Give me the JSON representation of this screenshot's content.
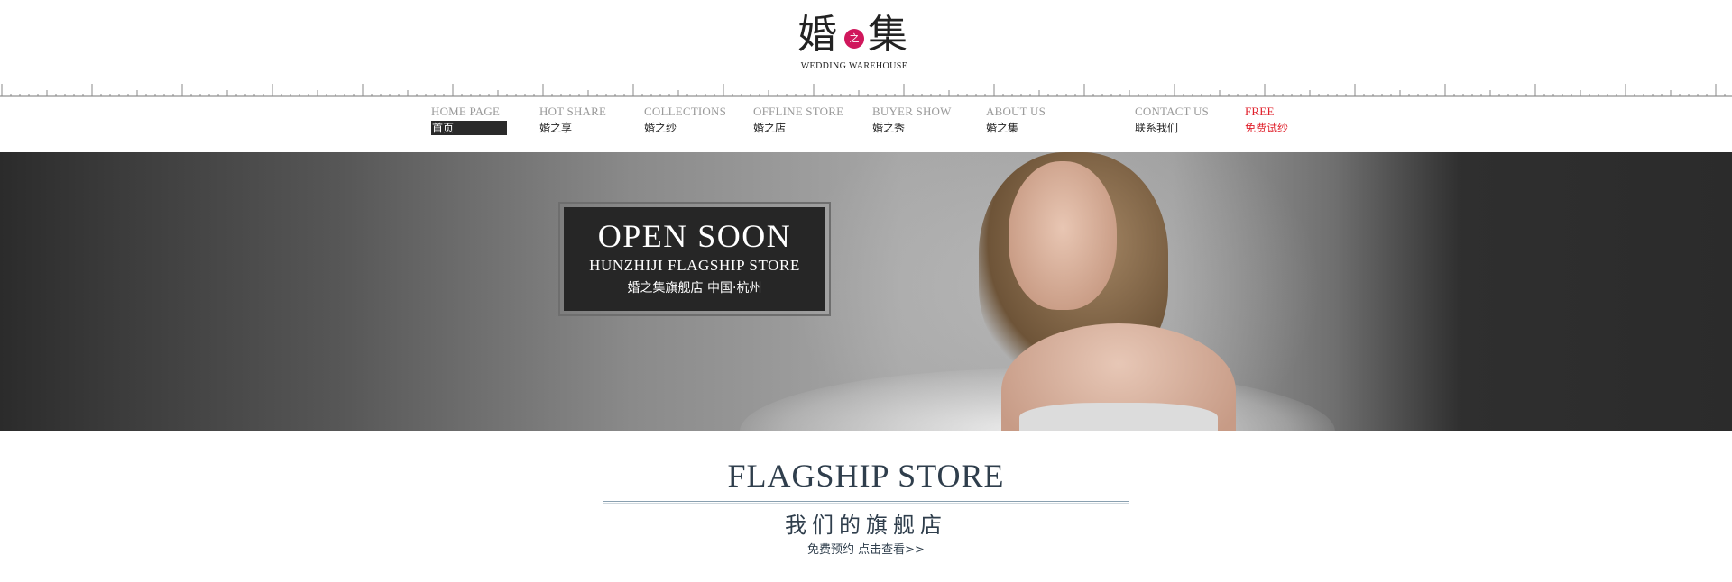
{
  "logo": {
    "char1": "婚",
    "dot": "之",
    "char2": "集",
    "subtitle": "WEDDING  WAREHOUSE",
    "accent": "#d0175c"
  },
  "nav": {
    "items": [
      {
        "en": "HOME PAGE",
        "cn": "首页",
        "active": true
      },
      {
        "en": "HOT SHARE",
        "cn": "婚之享"
      },
      {
        "en": "COLLECTIONS",
        "cn": "婚之纱"
      },
      {
        "en": "OFFLINE STORE",
        "cn": "婚之店"
      },
      {
        "en": "BUYER SHOW",
        "cn": "婚之秀"
      },
      {
        "en": "ABOUT US",
        "cn": "婚之集"
      },
      {
        "en": "CONTACT US",
        "cn": "联系我们"
      },
      {
        "en": "FREE",
        "cn": "免费试纱",
        "highlight": "#e0202b"
      }
    ]
  },
  "banner": {
    "title": "OPEN SOON",
    "subtitle": "HUNZHIJI FLAGSHIP STORE",
    "location": "婚之集旗舰店  中国·杭州"
  },
  "section": {
    "title": "FLAGSHIP STORE",
    "subtitle": "我们的旗舰店",
    "link": "免费预约 点击查看>>"
  }
}
